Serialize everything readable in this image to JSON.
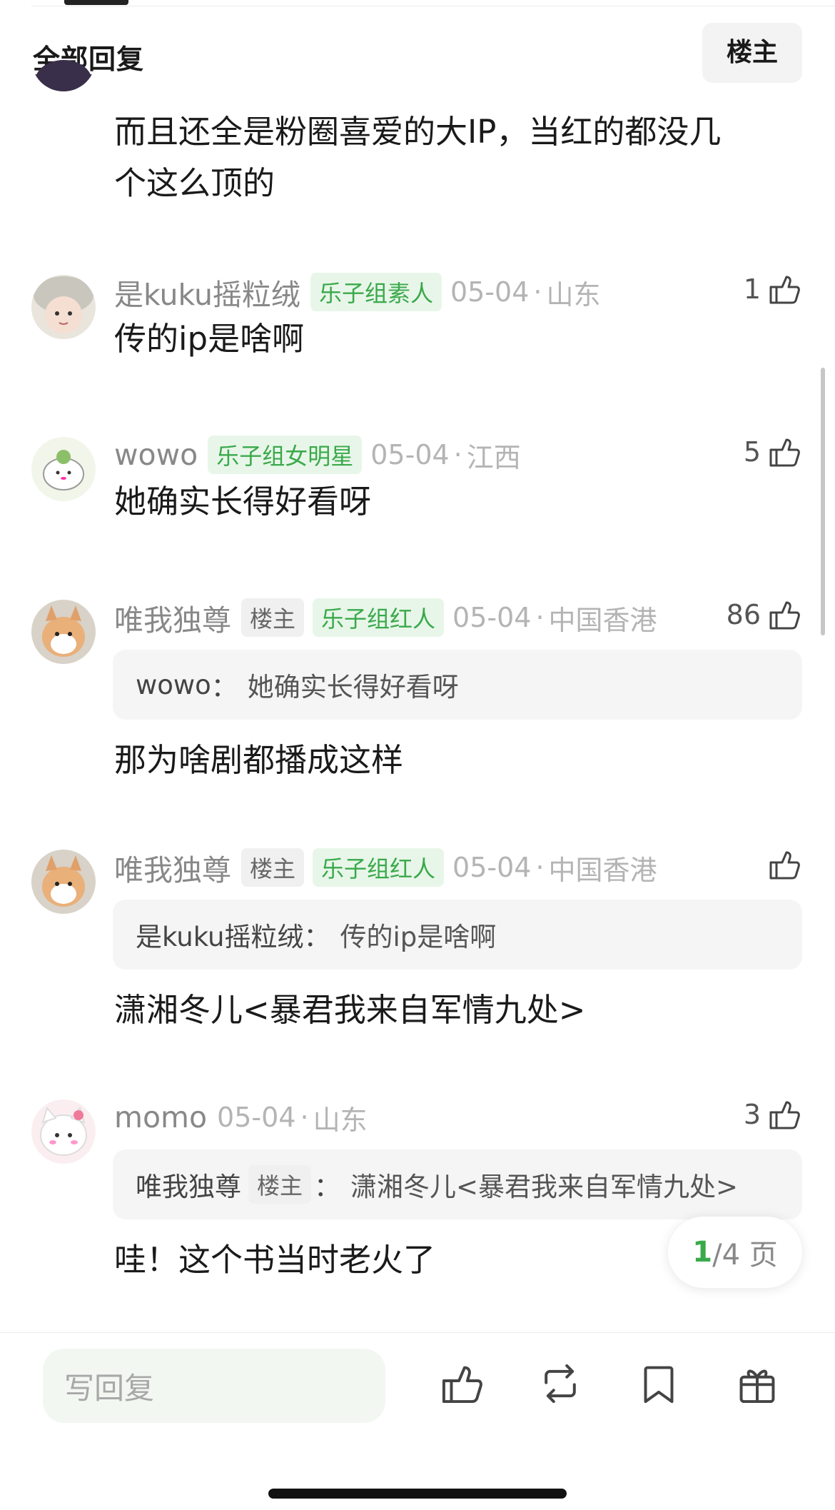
{
  "header": {
    "title": "全部回复",
    "op_filter_label": "楼主"
  },
  "comments": [
    {
      "text_line1": "而且还全是粉圈喜爱的大IP，当红的都没几",
      "text_line2": "个这么顶的"
    },
    {
      "username": "是kuku摇粒绒",
      "title_badge": "乐子组素人",
      "date": "05-04",
      "location": "山东",
      "likes": "1",
      "text": "传的ip是啥啊"
    },
    {
      "username": "wowo",
      "title_badge": "乐子组女明星",
      "date": "05-04",
      "location": "江西",
      "likes": "5",
      "text": "她确实长得好看呀"
    },
    {
      "username": "唯我独尊",
      "op_badge": "楼主",
      "title_badge": "乐子组红人",
      "date": "05-04",
      "location": "中国香港",
      "likes": "86",
      "quote": {
        "name": "wowo",
        "separator": "：",
        "text": "她确实长得好看呀"
      },
      "text": "那为啥剧都播成这样"
    },
    {
      "username": "唯我独尊",
      "op_badge": "楼主",
      "title_badge": "乐子组红人",
      "date": "05-04",
      "location": "中国香港",
      "likes": "",
      "quote": {
        "name": "是kuku摇粒绒",
        "separator": "：",
        "text": "传的ip是啥啊"
      },
      "text": "潇湘冬儿<暴君我来自军情九处>"
    },
    {
      "username": "momo",
      "date": "05-04",
      "location": "山东",
      "likes": "3",
      "quote": {
        "name": "唯我独尊",
        "op_badge": "楼主",
        "separator": "：",
        "text": "潇湘冬儿<暴君我来自军情九处>"
      },
      "text": "哇！这个书当时老火了"
    }
  ],
  "pagination": {
    "current": "1",
    "rest": "/4 页"
  },
  "bottom_bar": {
    "reply_placeholder": "写回复"
  },
  "colors": {
    "accent_green": "#3aa94b",
    "badge_green_bg": "#e8f6e9",
    "meta_gray": "#b4b4b4"
  }
}
